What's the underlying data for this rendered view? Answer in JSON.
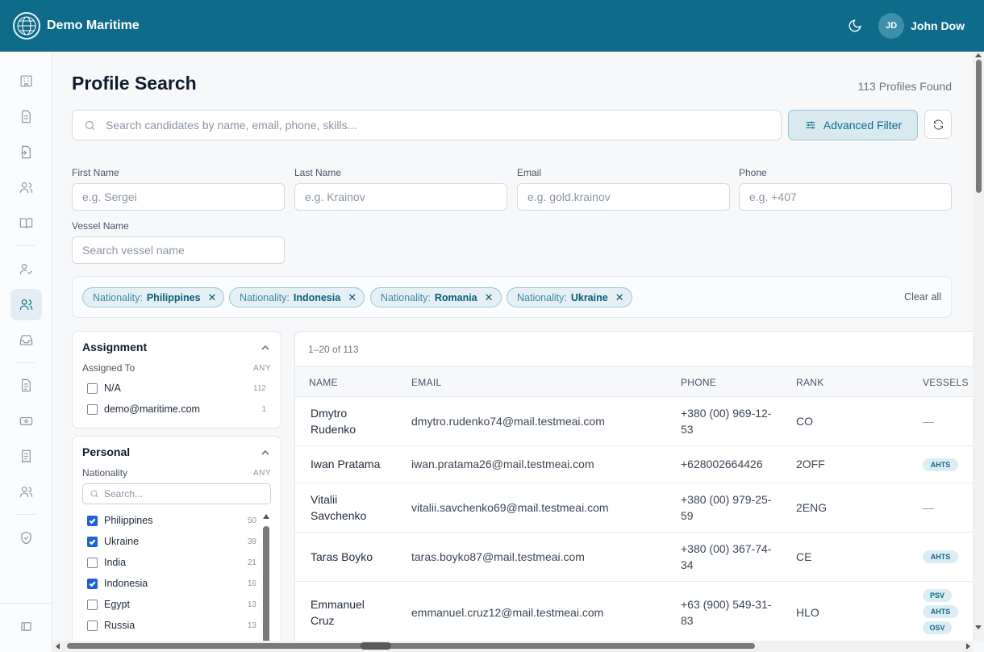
{
  "header": {
    "brand": "Demo Maritime",
    "user_initials": "JD",
    "user_name": "John Dow"
  },
  "page": {
    "title": "Profile Search",
    "profiles_found": "113 Profiles Found"
  },
  "search": {
    "placeholder": "Search candidates by name, email, phone, skills...",
    "advanced_filter": "Advanced Filter"
  },
  "fields": {
    "first_name": {
      "label": "First Name",
      "placeholder": "e.g. Sergei"
    },
    "last_name": {
      "label": "Last Name",
      "placeholder": "e.g. Krainov"
    },
    "email": {
      "label": "Email",
      "placeholder": "e.g. gold.krainov"
    },
    "phone": {
      "label": "Phone",
      "placeholder": "e.g. +407"
    },
    "vessel_name": {
      "label": "Vessel Name",
      "placeholder": "Search vessel name"
    }
  },
  "chips": [
    {
      "key": "Nationality:",
      "value": "Philippines"
    },
    {
      "key": "Nationality:",
      "value": "Indonesia"
    },
    {
      "key": "Nationality:",
      "value": "Romania"
    },
    {
      "key": "Nationality:",
      "value": "Ukraine"
    }
  ],
  "clear_all": "Clear all",
  "assignment": {
    "title": "Assignment",
    "sub_label": "Assigned To",
    "any": "ANY",
    "options": [
      {
        "label": "N/A",
        "count": "112",
        "checked": false
      },
      {
        "label": "demo@maritime.com",
        "count": "1",
        "checked": false
      }
    ]
  },
  "personal": {
    "title": "Personal",
    "sub_label": "Nationality",
    "any": "ANY",
    "search_placeholder": "Search...",
    "options": [
      {
        "label": "Philippines",
        "count": "50",
        "checked": true
      },
      {
        "label": "Ukraine",
        "count": "39",
        "checked": true
      },
      {
        "label": "India",
        "count": "21",
        "checked": false
      },
      {
        "label": "Indonesia",
        "count": "16",
        "checked": true
      },
      {
        "label": "Egypt",
        "count": "13",
        "checked": false
      },
      {
        "label": "Russia",
        "count": "13",
        "checked": false
      }
    ]
  },
  "table": {
    "range": "1–20 of 113",
    "headers": {
      "name": "NAME",
      "email": "EMAIL",
      "phone": "PHONE",
      "rank": "RANK",
      "vessels": "VESSELS"
    },
    "rows": [
      {
        "name": "Dmytro Rudenko",
        "email": "dmytro.rudenko74@mail.testmeai.com",
        "phone": "+380 (00) 969-12-53",
        "rank": "CO",
        "vessels": [],
        "empty": "—"
      },
      {
        "name": "Iwan Pratama",
        "email": "iwan.pratama26@mail.testmeai.com",
        "phone": "+628002664426",
        "rank": "2OFF",
        "vessels": [
          "AHTS"
        ],
        "empty": ""
      },
      {
        "name": "Vitalii Savchenko",
        "email": "vitalii.savchenko69@mail.testmeai.com",
        "phone": "+380 (00) 979-25-59",
        "rank": "2ENG",
        "vessels": [],
        "empty": "—"
      },
      {
        "name": "Taras Boyko",
        "email": "taras.boyko87@mail.testmeai.com",
        "phone": "+380 (00) 367-74-34",
        "rank": "CE",
        "vessels": [
          "AHTS"
        ],
        "empty": ""
      },
      {
        "name": "Emmanuel Cruz",
        "email": "emmanuel.cruz12@mail.testmeai.com",
        "phone": "+63 (900) 549-31-83",
        "rank": "HLO",
        "vessels": [
          "PSV",
          "AHTS",
          "OSV"
        ],
        "empty": ""
      }
    ]
  },
  "colors": {
    "brand": "#0e6b8a",
    "checkbox": "#1c63d8",
    "chip_bg": "#e4f0f5"
  },
  "sidebar_icons": [
    "dashboard-icon",
    "document-icon",
    "import-icon",
    "users-icon",
    "book-icon",
    "user-check-icon",
    "users-icon",
    "inbox-icon",
    "file-icon",
    "card-icon",
    "receipt-icon",
    "team-icon",
    "shield-icon",
    "collapse-sidebar-icon"
  ]
}
